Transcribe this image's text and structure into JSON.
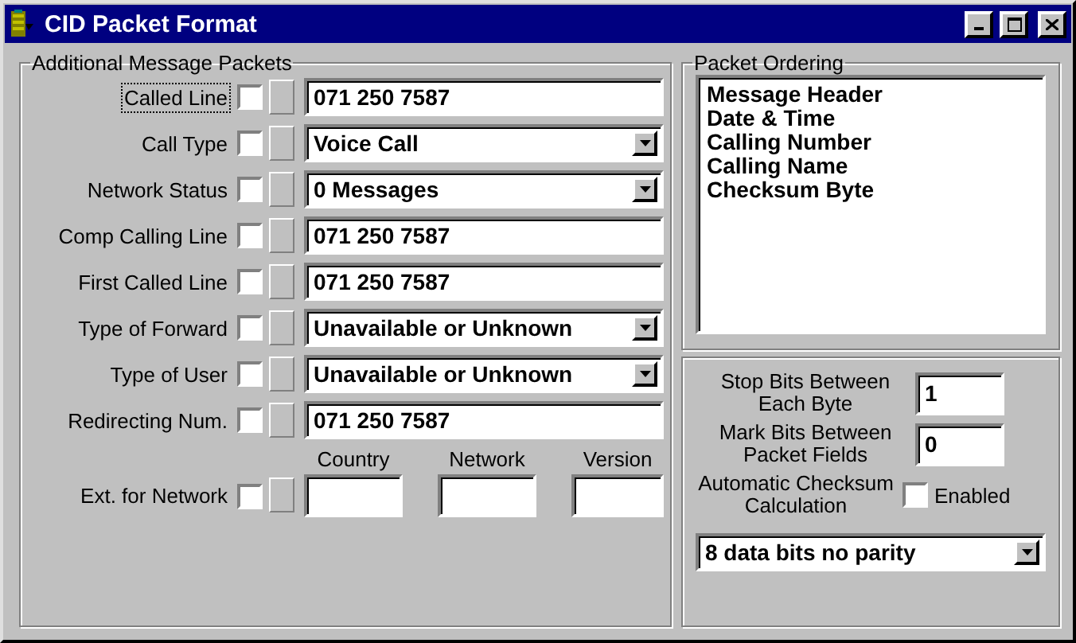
{
  "window": {
    "title": "CID Packet Format"
  },
  "message_packets": {
    "title": "Additional Message Packets",
    "rows": [
      {
        "label": "Called Line",
        "checked": false,
        "focused": true,
        "kind": "text",
        "value": "071 250 7587"
      },
      {
        "label": "Call Type",
        "checked": false,
        "focused": false,
        "kind": "select",
        "value": "Voice Call"
      },
      {
        "label": "Network Status",
        "checked": false,
        "focused": false,
        "kind": "select",
        "value": "0 Messages"
      },
      {
        "label": "Comp Calling Line",
        "checked": false,
        "focused": false,
        "kind": "text",
        "value": "071 250 7587"
      },
      {
        "label": "First Called Line",
        "checked": false,
        "focused": false,
        "kind": "text",
        "value": "071 250 7587"
      },
      {
        "label": "Type of Forward",
        "checked": false,
        "focused": false,
        "kind": "select",
        "value": "Unavailable or Unknown"
      },
      {
        "label": "Type of User",
        "checked": false,
        "focused": false,
        "kind": "select",
        "value": "Unavailable or Unknown"
      },
      {
        "label": "Redirecting Num.",
        "checked": false,
        "focused": false,
        "kind": "text",
        "value": "071 250 7587"
      }
    ],
    "extension": {
      "label": "Ext. for Network",
      "checked": false,
      "columns": [
        {
          "header": "Country"
        },
        {
          "header": "Network"
        },
        {
          "header": "Version"
        }
      ]
    }
  },
  "packet_ordering": {
    "title": "Packet Ordering",
    "items": [
      "Message Header",
      "Date & Time",
      "Calling Number",
      "Calling Name",
      "Checksum Byte"
    ]
  },
  "settings": {
    "stop_bits": {
      "label": "Stop Bits Between Each Byte",
      "value": "1"
    },
    "mark_bits": {
      "label": "Mark Bits Between Packet Fields",
      "value": "0"
    },
    "checksum": {
      "label": "Automatic Checksum Calculation",
      "option": "Enabled",
      "checked": false
    },
    "format": {
      "value": "8 data bits no parity"
    }
  }
}
